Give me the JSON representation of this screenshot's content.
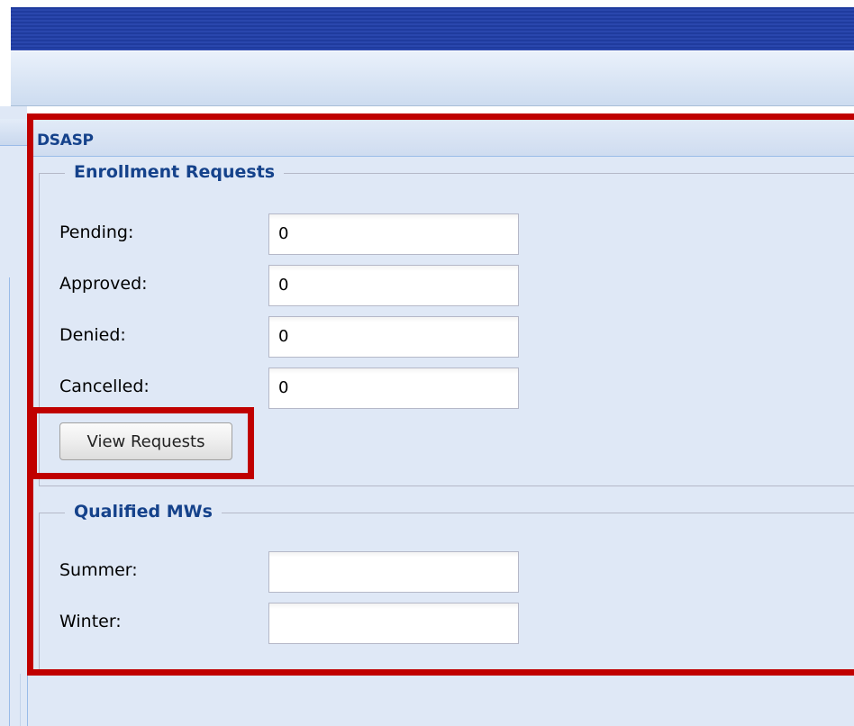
{
  "panel": {
    "title": "DSASP"
  },
  "enrollment": {
    "legend": "Enrollment Requests",
    "rows": [
      {
        "label": "Pending:",
        "value": "0"
      },
      {
        "label": "Approved:",
        "value": "0"
      },
      {
        "label": "Denied:",
        "value": "0"
      },
      {
        "label": "Cancelled:",
        "value": "0"
      }
    ],
    "button_label": "View Requests"
  },
  "qualified": {
    "legend": "Qualified MWs",
    "rows": [
      {
        "label": "Summer:",
        "value": ""
      },
      {
        "label": "Winter:",
        "value": ""
      }
    ]
  },
  "colors": {
    "header_bar": "#1f3b9e",
    "panel_bg": "#dfe8f6",
    "title_text": "#15428b",
    "highlight": "#c00000"
  }
}
